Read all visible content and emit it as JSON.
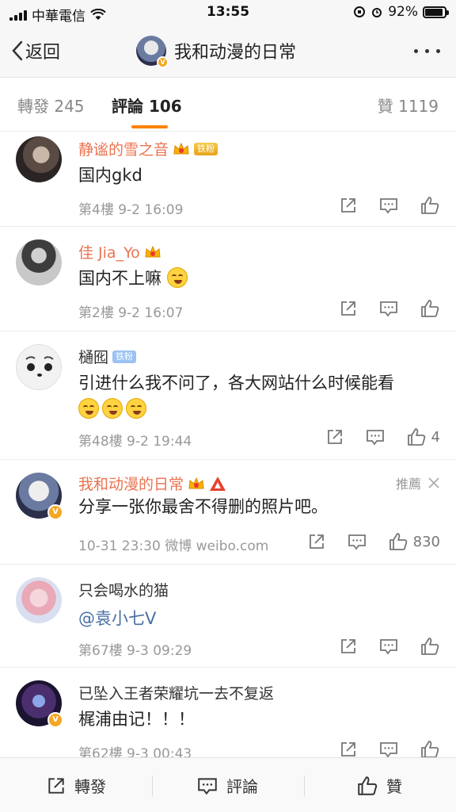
{
  "status_bar": {
    "carrier": "中華電信",
    "time": "13:55",
    "battery": "92%",
    "battery_level": 0.92
  },
  "nav": {
    "back_label": "返回",
    "title": "我和动漫的日常"
  },
  "tabs": {
    "repost": {
      "label": "轉發",
      "count": "245"
    },
    "comment": {
      "label": "評論",
      "count": "106"
    },
    "like": {
      "label": "贊",
      "count": "1119"
    }
  },
  "comments": [
    {
      "name": "静谧的雪之音",
      "badge": "铁粉",
      "text": "国内gkd",
      "meta": "第4樓 9-2 16:09"
    },
    {
      "name": "佳 Jia_Yo",
      "text": "国内不上嘛",
      "meta": "第2樓 9-2 16:07"
    },
    {
      "name": "樋囮",
      "badge": "铁粉",
      "text": "引进什么我不问了，各大网站什么时候能看",
      "meta": "第48樓 9-2 19:44",
      "like_count": "4"
    },
    {
      "name": "我和动漫的日常",
      "pin_label": "推薦",
      "text": "分享一张你最舍不得删的照片吧。",
      "meta": "10-31 23:30 微博 weibo.com",
      "like_count": "830"
    },
    {
      "name": "只会喝水的猫",
      "mention": "@袁小七Ⅴ",
      "meta": "第67樓 9-3 09:29"
    },
    {
      "name": "已坠入王者荣耀坑一去不复返",
      "text": "梶浦由记！！！",
      "meta": "第62樓 9-3 00:43"
    }
  ],
  "bottom_bar": {
    "repost": "轉發",
    "comment": "評論",
    "like": "贊"
  },
  "colors": {
    "accent": "#ff8200",
    "vip_name": "#eb7350",
    "mention": "#4a6fa5"
  }
}
